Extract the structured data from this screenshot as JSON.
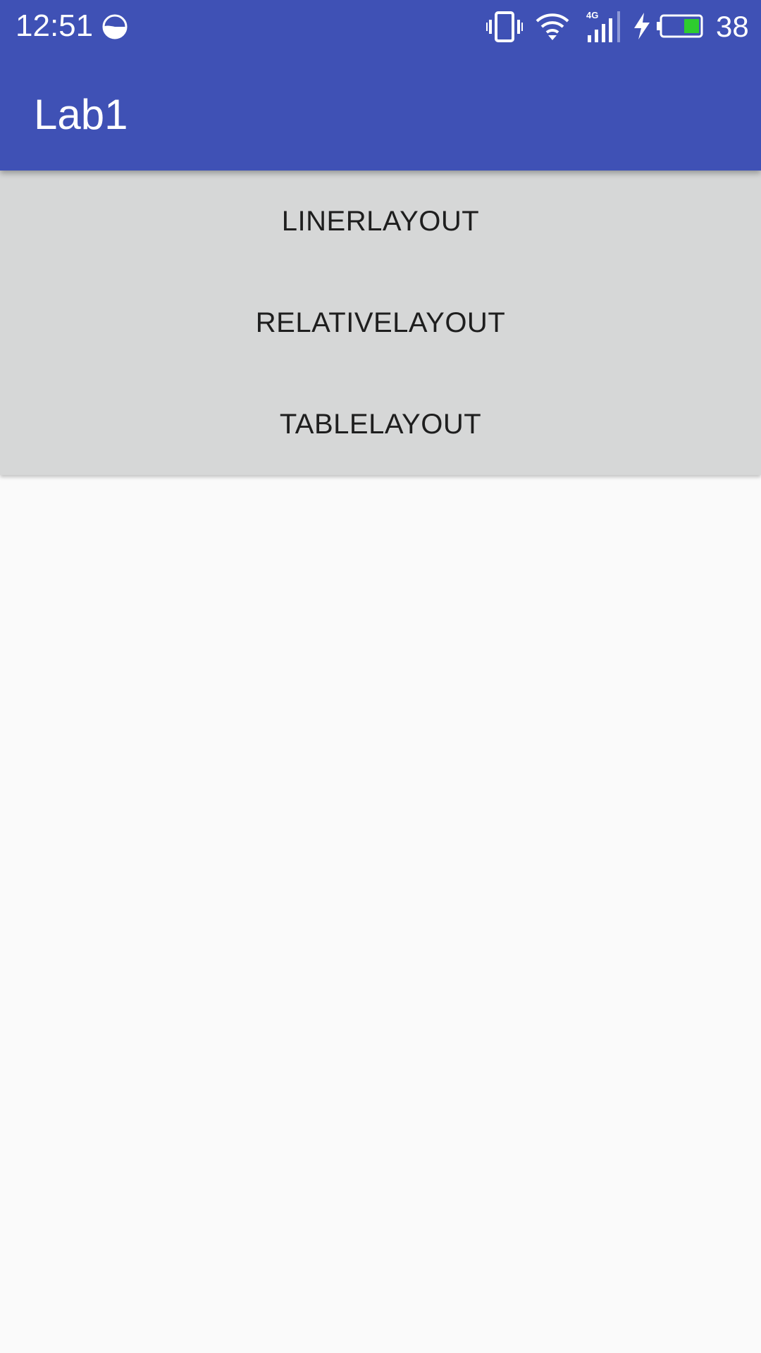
{
  "status_bar": {
    "time": "12:51",
    "battery_level": "38",
    "icons": [
      "data-saver-icon",
      "vibrate-icon",
      "wifi-icon",
      "signal-4g-icon",
      "charging-icon",
      "battery-icon"
    ]
  },
  "app_bar": {
    "title": "Lab1"
  },
  "buttons": [
    {
      "label": "LINERLAYOUT"
    },
    {
      "label": "RELATIVELAYOUT"
    },
    {
      "label": "TABLELAYOUT"
    }
  ],
  "colors": {
    "primary": "#3f51b5",
    "button_background": "#d6d7d7",
    "button_text": "#1e1e1e",
    "window_background": "#fafafa",
    "battery_fill": "#2ecc2e"
  }
}
